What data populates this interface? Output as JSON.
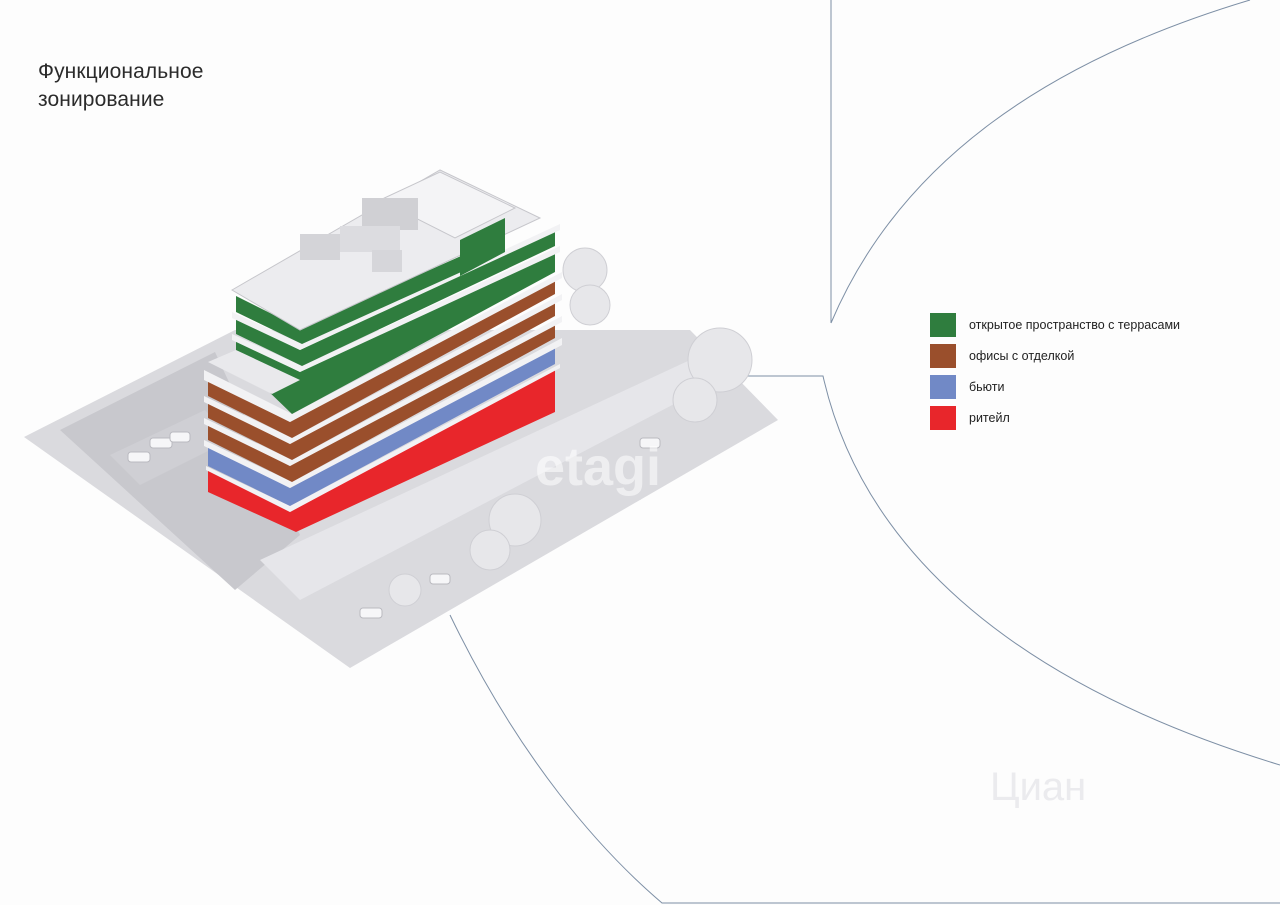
{
  "title": {
    "line1": "Функциональное",
    "line2": "зонирование"
  },
  "legend": {
    "items": [
      {
        "label": "открытое пространство с террасами",
        "color": "#2f7d3e"
      },
      {
        "label": "офисы с отделкой",
        "color": "#9a4f2c"
      },
      {
        "label": "бьюти",
        "color": "#7189c6"
      },
      {
        "label": "ритейл",
        "color": "#e8262b"
      }
    ]
  },
  "watermarks": {
    "center": "etagi",
    "bottom": "Циан"
  },
  "colors": {
    "terrace": "#2f7d3e",
    "office": "#9a4f2c",
    "beauty": "#7189c6",
    "retail": "#e8262b",
    "slab": "#e3e3e6",
    "ground": "#d9d9de",
    "curve": "#7d8fa5"
  }
}
